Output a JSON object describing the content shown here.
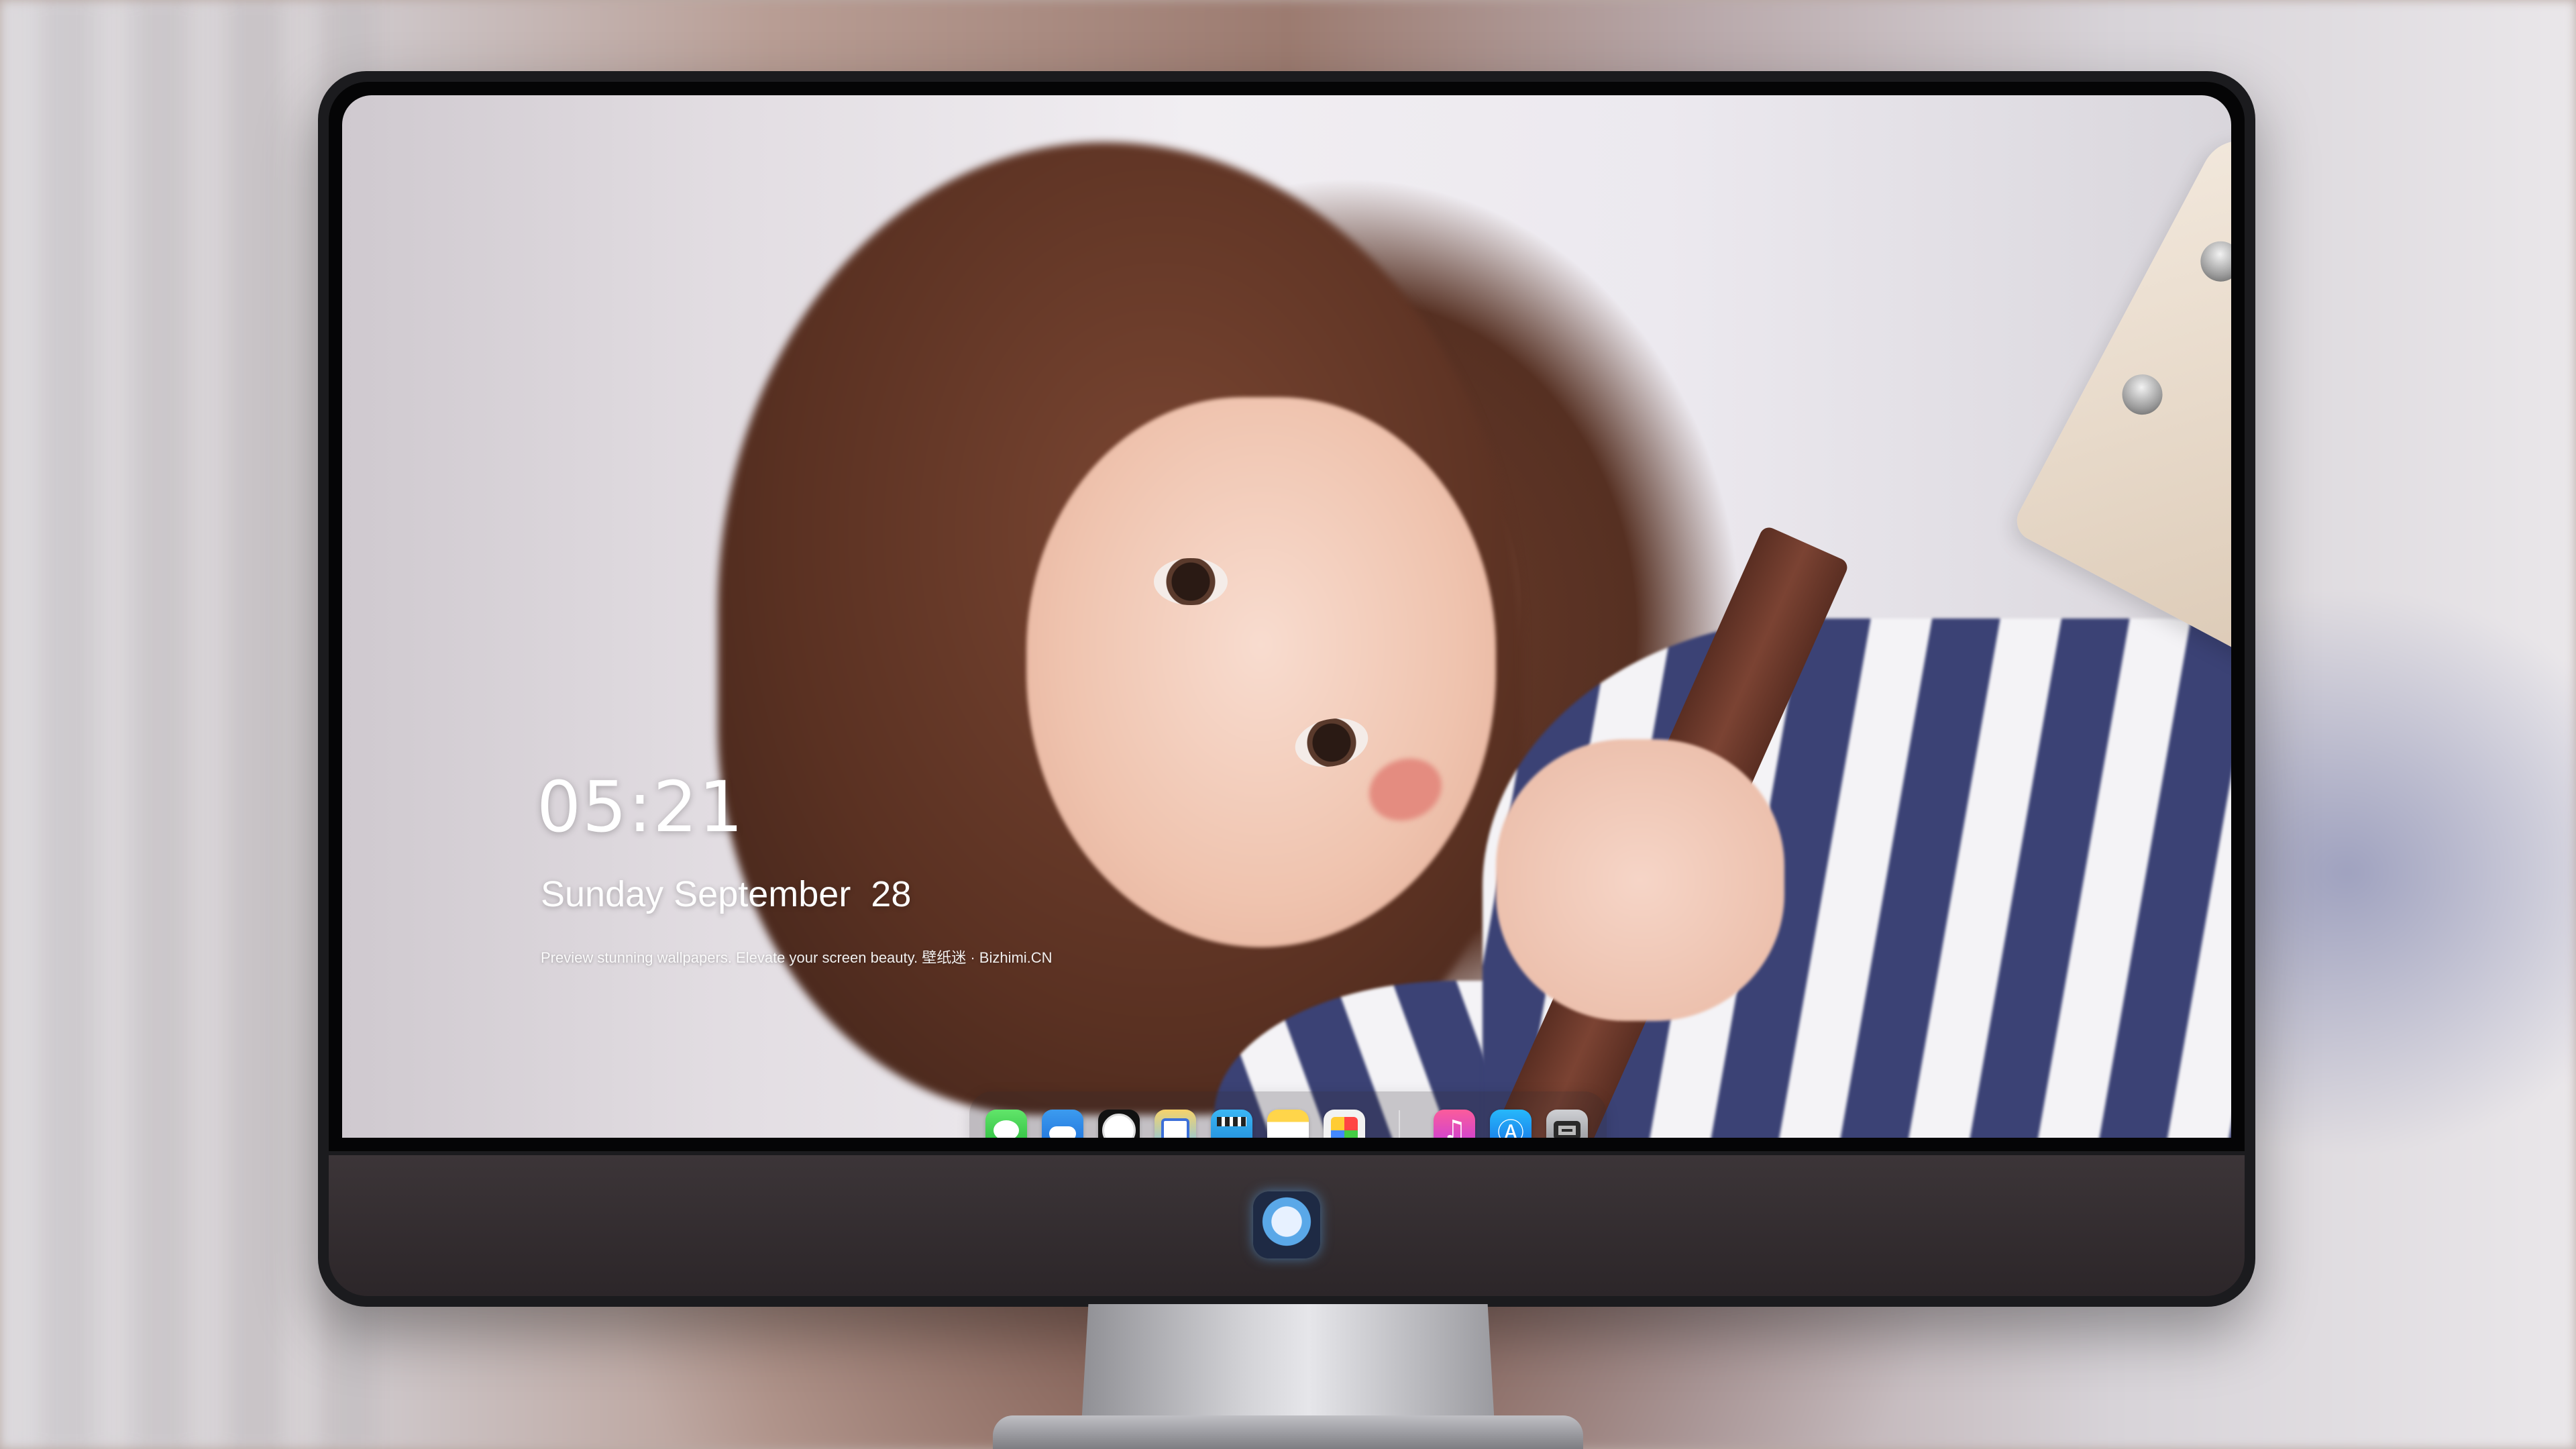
{
  "lockscreen": {
    "time": "05:21",
    "date": "Sunday September  28",
    "tagline": "Preview stunning wallpapers. Elevate your screen beauty. 壁纸迷 · Bizhimi.CN"
  },
  "dock": {
    "apps": [
      {
        "name": "Messages",
        "icon": "messages-icon"
      },
      {
        "name": "Weather",
        "icon": "weather-icon"
      },
      {
        "name": "Clock",
        "icon": "clock-icon"
      },
      {
        "name": "Preview",
        "icon": "preview-icon"
      },
      {
        "name": "Clips",
        "icon": "clapperboard-icon"
      },
      {
        "name": "Notes",
        "icon": "notes-icon"
      },
      {
        "name": "Photos",
        "icon": "photos-icon"
      },
      {
        "name": "Music",
        "icon": "music-note-icon"
      },
      {
        "name": "App Store",
        "icon": "app-store-icon"
      },
      {
        "name": "Camera",
        "icon": "camera-icon"
      }
    ]
  },
  "colors": {
    "monitor_frame": "#1b1b1e",
    "chin": "#3c3538",
    "stripe_navy": "#3b4275",
    "text": "#ffffff"
  }
}
